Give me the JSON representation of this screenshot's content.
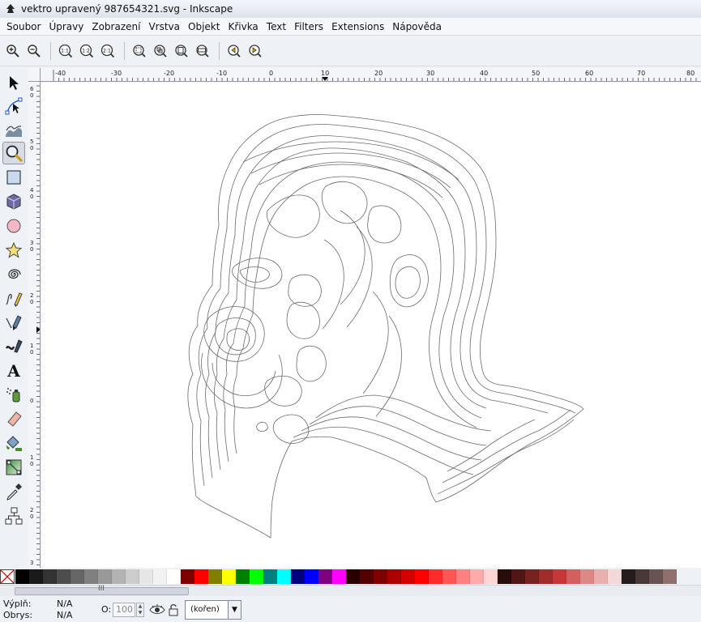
{
  "window": {
    "title": "vektro upravený 987654321.svg - Inkscape"
  },
  "menu": [
    {
      "label": "Soubor"
    },
    {
      "label": "Úpravy"
    },
    {
      "label": "Zobrazení"
    },
    {
      "label": "Vrstva"
    },
    {
      "label": "Objekt"
    },
    {
      "label": "Křivka"
    },
    {
      "label": "Text"
    },
    {
      "label": "Filters"
    },
    {
      "label": "Extensions"
    },
    {
      "label": "Nápověda"
    }
  ],
  "zoom_toolbar": [
    {
      "icon": "zoom-in-icon"
    },
    {
      "icon": "zoom-out-icon"
    },
    {
      "icon": "zoom-1-1-icon",
      "label": "1:1"
    },
    {
      "icon": "zoom-1-2-icon",
      "label": "1:2"
    },
    {
      "icon": "zoom-2-1-icon",
      "label": "2:1"
    },
    {
      "icon": "zoom-selection-icon"
    },
    {
      "icon": "zoom-drawing-icon"
    },
    {
      "icon": "zoom-page-icon"
    },
    {
      "icon": "zoom-page-width-icon"
    },
    {
      "icon": "zoom-previous-icon"
    },
    {
      "icon": "zoom-next-icon"
    }
  ],
  "tools": [
    {
      "icon": "selector-arrow-icon"
    },
    {
      "icon": "node-edit-icon"
    },
    {
      "icon": "tweak-icon"
    },
    {
      "icon": "zoom-tool-icon",
      "active": true
    },
    {
      "icon": "rectangle-icon"
    },
    {
      "icon": "3d-box-icon"
    },
    {
      "icon": "ellipse-icon"
    },
    {
      "icon": "star-icon"
    },
    {
      "icon": "spiral-icon"
    },
    {
      "icon": "pencil-icon"
    },
    {
      "icon": "pen-icon"
    },
    {
      "icon": "calligraphy-icon"
    },
    {
      "icon": "text-tool-icon",
      "label": "A"
    },
    {
      "icon": "spray-icon"
    },
    {
      "icon": "eraser-icon"
    },
    {
      "icon": "paint-bucket-icon"
    },
    {
      "icon": "gradient-icon"
    },
    {
      "icon": "dropper-icon"
    },
    {
      "icon": "connector-icon"
    }
  ],
  "ruler_top": [
    "-40",
    "-30",
    "-20",
    "-10",
    "0",
    "10",
    "20",
    "30",
    "40",
    "50",
    "60",
    "70",
    "80"
  ],
  "ruler_left": [
    "6",
    "0",
    "5",
    "0",
    "4",
    "0",
    "3",
    "0",
    "2",
    "0",
    "1",
    "0",
    "0",
    "1",
    "0",
    "2",
    "0",
    "3"
  ],
  "palette": [
    "#000000",
    "#1a1a1a",
    "#333333",
    "#4d4d4d",
    "#666666",
    "#808080",
    "#999999",
    "#b3b3b3",
    "#cccccc",
    "#e6e6e6",
    "#f2f2f2",
    "#ffffff",
    "#800000",
    "#ff0000",
    "#808000",
    "#ffff00",
    "#008000",
    "#00ff00",
    "#008080",
    "#00ffff",
    "#000080",
    "#0000ff",
    "#800080",
    "#ff00ff",
    "#2b0000",
    "#550000",
    "#800000",
    "#aa0000",
    "#d40000",
    "#ff0000",
    "#ff2a2a",
    "#ff5555",
    "#ff8080",
    "#ffaaaa",
    "#ffd5d5",
    "#280b0b",
    "#501616",
    "#782121",
    "#a02c2c",
    "#c83737",
    "#d35f5f",
    "#de8787",
    "#e9afaf",
    "#f4d7d7",
    "#241c1c",
    "#483737",
    "#6c5353",
    "#916f6f"
  ],
  "status": {
    "fill_label": "Výplň:",
    "fill_value": "N/A",
    "stroke_label": "Obrys:",
    "stroke_value": "N/A",
    "opacity_label": "O:",
    "opacity_value": "100",
    "layer": "(kořen)"
  },
  "scroll": {
    "thumb_grip": "III"
  }
}
